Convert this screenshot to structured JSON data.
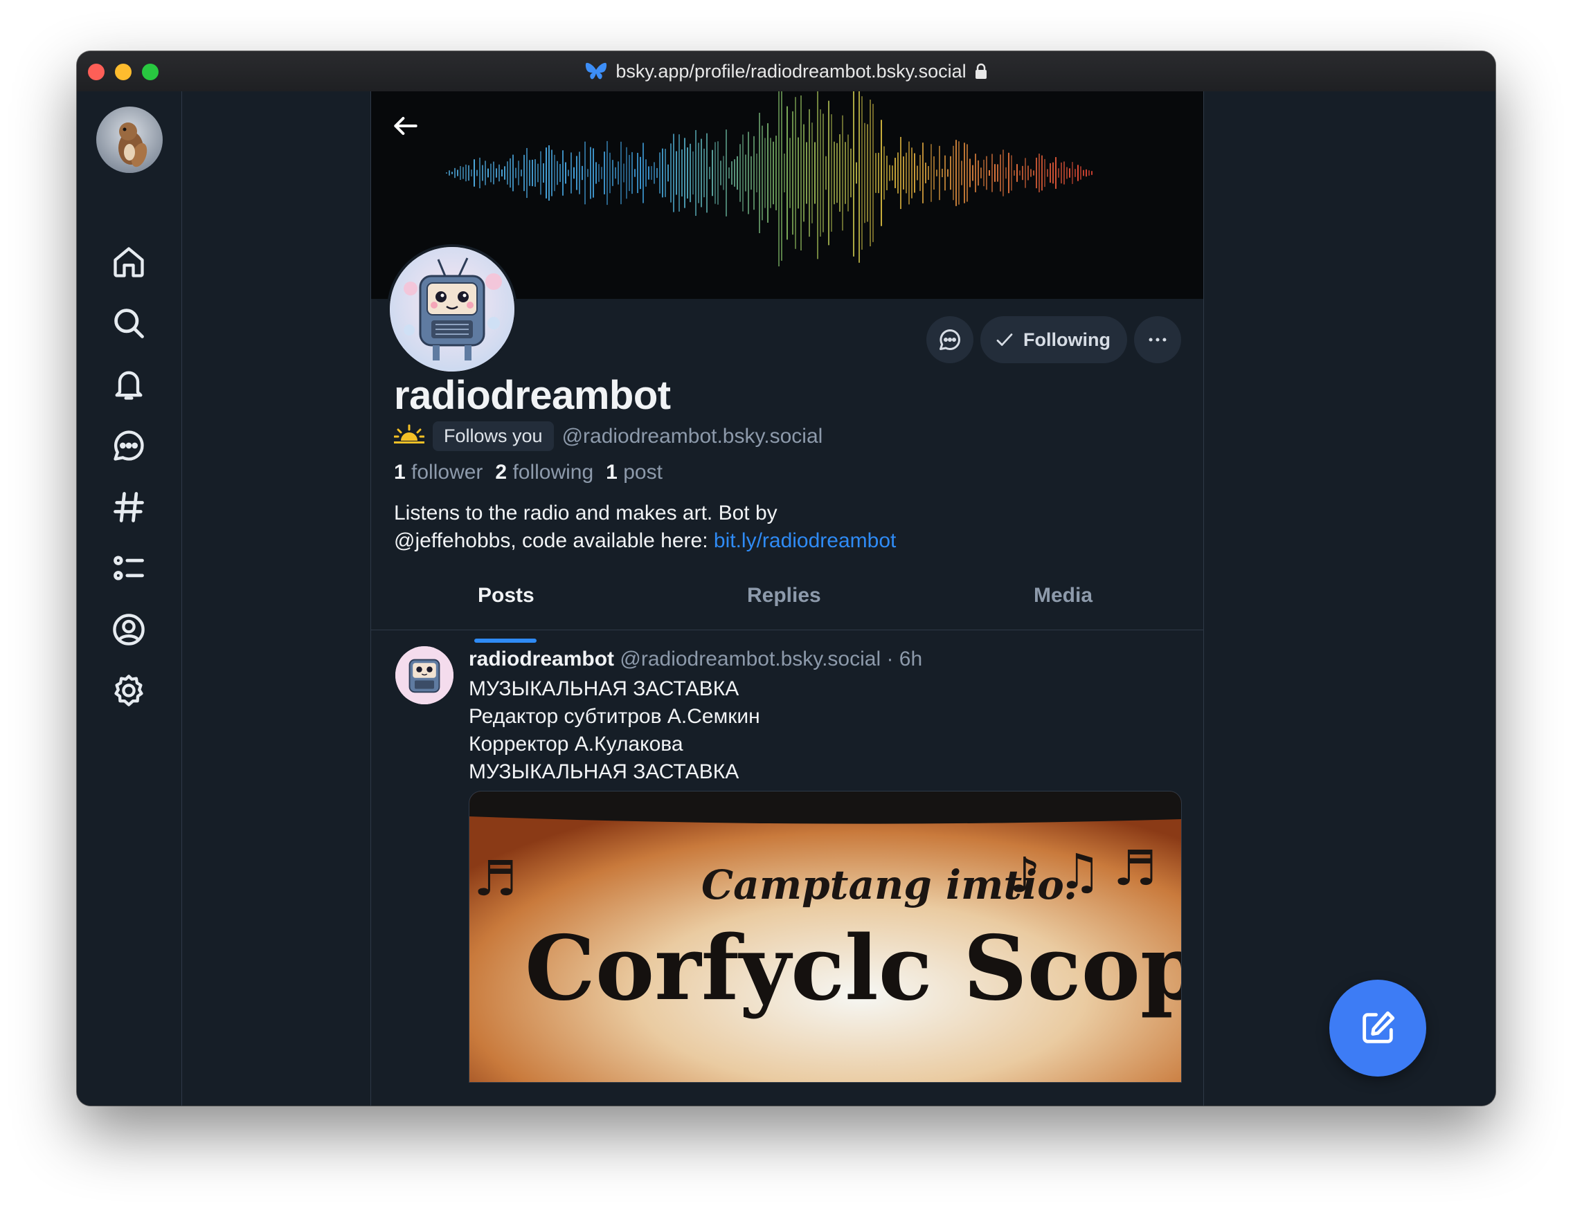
{
  "browser": {
    "url": "bsky.app/profile/radiodreambot.bsky.social"
  },
  "nav": {
    "items": [
      {
        "name": "home",
        "icon": "home-icon"
      },
      {
        "name": "search",
        "icon": "search-icon"
      },
      {
        "name": "notifications",
        "icon": "bell-icon"
      },
      {
        "name": "chat",
        "icon": "chat-icon"
      },
      {
        "name": "feeds",
        "icon": "hashtag-icon"
      },
      {
        "name": "lists",
        "icon": "list-icon"
      },
      {
        "name": "profile",
        "icon": "user-circle-icon"
      },
      {
        "name": "settings",
        "icon": "gear-icon"
      }
    ]
  },
  "profile": {
    "display_name": "radiodreambot",
    "follows_you": "Follows you",
    "handle": "@radiodreambot.bsky.social",
    "followers_count": "1",
    "followers_label": "follower",
    "following_count": "2",
    "following_label": "following",
    "posts_count": "1",
    "posts_label": "post",
    "bio_line1": "Listens to the radio and makes art. Bot by",
    "bio_line2": "@jeffehobbs, code available here: ",
    "bio_link": "bit.ly/radiodreambot",
    "follow_button": "Following"
  },
  "tabs": {
    "posts": "Posts",
    "replies": "Replies",
    "media": "Media",
    "active": "posts"
  },
  "post": {
    "author": "radiodreambot",
    "handle": "@radiodreambot.bsky.social",
    "time": "· 6h",
    "lines": [
      "МУЗЫКАЛЬНАЯ ЗАСТАВКА",
      "Редактор субтитров А.Семкин",
      "Корректор А.Кулакова",
      "МУЗЫКАЛЬНАЯ ЗАСТАВКА"
    ],
    "image_text_top": "Camptang imtio.",
    "image_text_main": "Corfyclc Scopie"
  },
  "colors": {
    "background": "#161e27",
    "accent": "#2f8bf5",
    "fab": "#3d7cf5"
  }
}
